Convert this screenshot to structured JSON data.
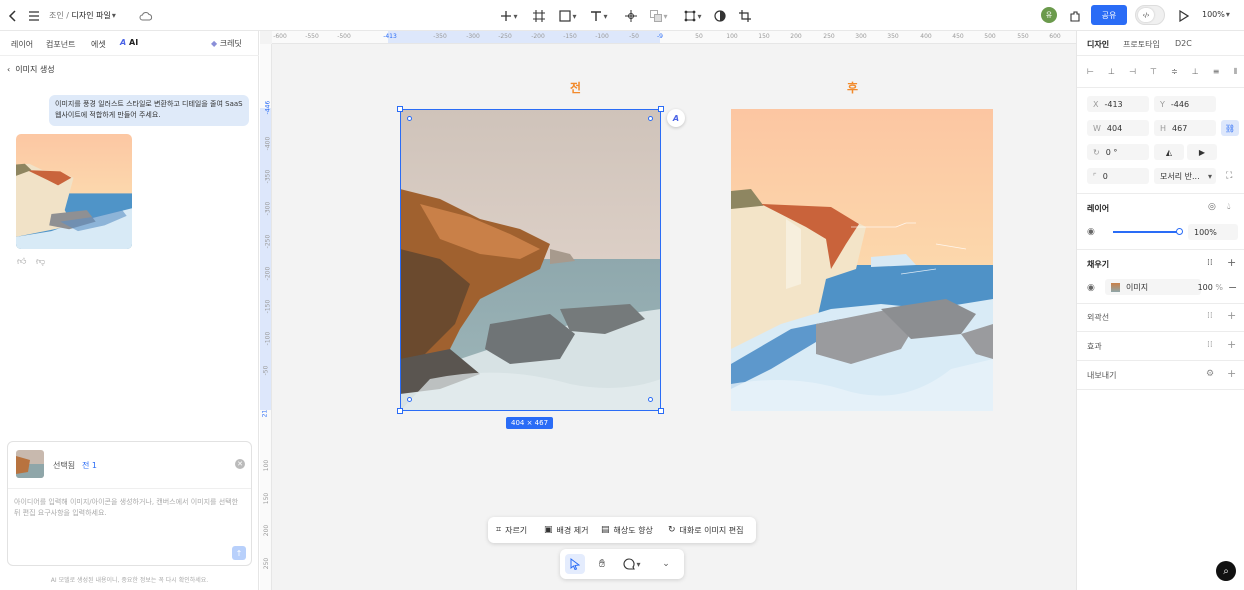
{
  "topbar": {
    "breadcrumb_parent": "조인",
    "breadcrumb_sep": "/",
    "file_name": "디자인 파일",
    "share_label": "공유",
    "avatar_initial": "유",
    "zoom": "100%"
  },
  "left": {
    "tabs": [
      "레이어",
      "컴포넌트",
      "에셋"
    ],
    "ai_tab": "AI",
    "plugin_label": "크레딧",
    "back_title": "이미지 생성",
    "user_message": "이미지를 풍경 일러스트 스타일로 변환하고 디테일을 줄여 SaaS 웹사이트에 적합하게 만들어 주세요.",
    "selected_label": "선택됨",
    "selected_value": "전 1",
    "input_placeholder": "아이디어를 입력해 이미지/아이콘을 생성하거나, 캔버스에서 이미지를 선택한 뒤 편집 요구사항을 입력하세요.",
    "disclaimer": "AI 모델로 생성된 내용이니, 중요한 정보는 꼭 다시 확인하세요."
  },
  "canvas": {
    "label_before": "전",
    "label_after": "후",
    "size_badge": "404 × 467",
    "ruler_h": [
      "-600",
      "-550",
      "-500",
      "-413",
      "-350",
      "-300",
      "-250",
      "-200",
      "-150",
      "-100",
      "-50",
      "-9",
      "50",
      "100",
      "150",
      "200",
      "250",
      "300",
      "350",
      "400",
      "450",
      "500",
      "550",
      "600"
    ],
    "ruler_v": [
      "-446",
      "-400",
      "-350",
      "-300",
      "-250",
      "-200",
      "-150",
      "-100",
      "-50",
      "21",
      "100",
      "150",
      "200",
      "250"
    ],
    "context_toolbar": [
      "자르기",
      "배경 제거",
      "해상도 향상",
      "대화로 이미지 편집"
    ]
  },
  "right": {
    "tabs": [
      "디자인",
      "프로토타입",
      "D2C"
    ],
    "x_label": "X",
    "x_value": "-413",
    "y_label": "Y",
    "y_value": "-446",
    "w_label": "W",
    "w_value": "404",
    "h_label": "H",
    "h_value": "467",
    "rotation": "0 °",
    "radius": "0",
    "corner_mode": "모서리 반...",
    "layer_title": "레이어",
    "opacity": "100%",
    "fill_title": "채우기",
    "fill_name": "이미지",
    "fill_opacity": "100",
    "fill_unit": "%",
    "stroke_title": "외곽선",
    "effect_title": "효과",
    "export_title": "내보내기"
  }
}
